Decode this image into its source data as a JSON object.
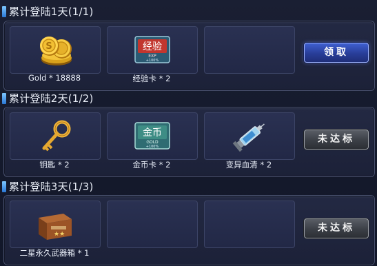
{
  "sections": [
    {
      "title": "累计登陆1天(1/1)",
      "items": [
        {
          "label": "Gold * 18888",
          "icon": "gold-coins-icon"
        },
        {
          "label": "经验卡 * 2",
          "icon": "exp-card-icon",
          "card_text": "经验",
          "card_sub": "EXP",
          "card_pct": "+100%"
        },
        {
          "label": "",
          "icon": ""
        }
      ],
      "button": "领取",
      "button_state": "claimable"
    },
    {
      "title": "累计登陆2天(1/2)",
      "items": [
        {
          "label": "钥匙 * 2",
          "icon": "key-icon"
        },
        {
          "label": "金币卡 * 2",
          "icon": "gold-card-icon",
          "card_text": "金币",
          "card_sub": "GOLD",
          "card_pct": "+100%"
        },
        {
          "label": "变异血清 * 2",
          "icon": "serum-syringe-icon"
        }
      ],
      "button": "未达标",
      "button_state": "disabled"
    },
    {
      "title": "累计登陆3天(1/3)",
      "items": [
        {
          "label": "二星永久武器箱 * 1",
          "icon": "weapon-crate-icon"
        },
        {
          "label": "",
          "icon": ""
        },
        {
          "label": "",
          "icon": ""
        }
      ],
      "button": "未达标",
      "button_state": "disabled"
    }
  ],
  "colors": {
    "accent": "#2a78d6",
    "claim_button": "#283d98",
    "disabled_button": "#3b3f46"
  }
}
